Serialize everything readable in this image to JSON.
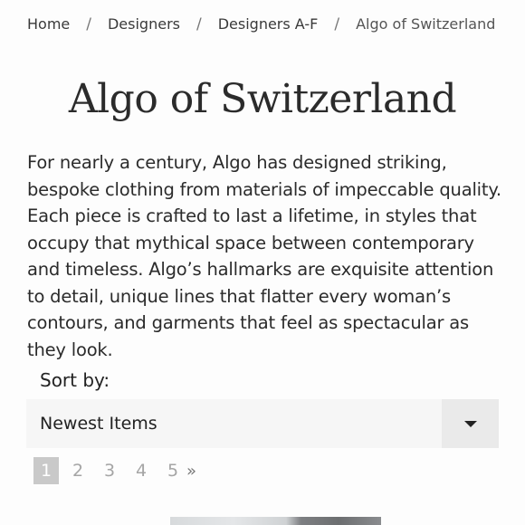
{
  "breadcrumb": {
    "items": [
      "Home",
      "Designers",
      "Designers A-F",
      "Algo of Switzerland"
    ],
    "separator": "/"
  },
  "page": {
    "title": "Algo of Switzerland",
    "description": "For nearly a century, Algo has designed striking, bespoke clothing from materials of impeccable quality. Each piece is crafted to last a lifetime, in styles that occupy that mythical space between contemporary and timeless. Algo’s hallmarks are exquisite attention to detail, unique lines that flatter every woman’s contours, and garments that feel as spectacular as they look."
  },
  "sort": {
    "label": "Sort by:",
    "selected": "Newest Items"
  },
  "pagination": {
    "pages": [
      "1",
      "2",
      "3",
      "4",
      "5"
    ],
    "current": "1",
    "next_label": "»"
  },
  "icons": {
    "sort_toggle": "chevron-down-icon"
  }
}
